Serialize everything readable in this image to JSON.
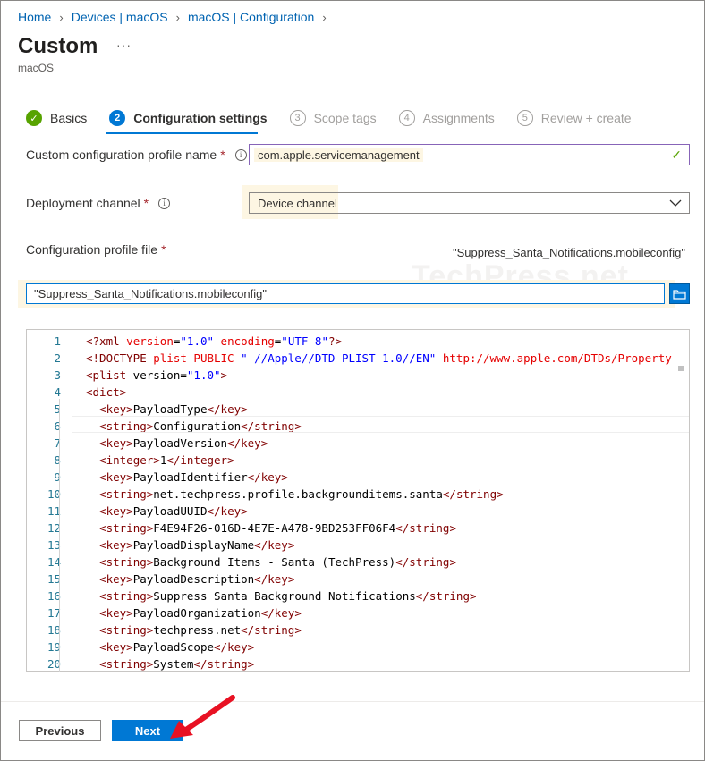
{
  "breadcrumb": [
    "Home",
    "Devices | macOS",
    "macOS | Configuration"
  ],
  "page": {
    "title": "Custom",
    "more": "···",
    "subtitle": "macOS"
  },
  "steps": [
    {
      "num": "✓",
      "label": "Basics",
      "state": "done"
    },
    {
      "num": "2",
      "label": "Configuration settings",
      "state": "active"
    },
    {
      "num": "3",
      "label": "Scope tags",
      "state": "pending"
    },
    {
      "num": "4",
      "label": "Assignments",
      "state": "pending"
    },
    {
      "num": "5",
      "label": "Review + create",
      "state": "pending"
    }
  ],
  "form": {
    "profile_name_label": "Custom configuration profile name",
    "profile_name_value": "com.apple.servicemanagement",
    "channel_label": "Deployment channel",
    "channel_value": "Device channel",
    "file_label": "Configuration profile file",
    "file_name_display": "\"Suppress_Santa_Notifications.mobileconfig\"",
    "file_input_value": "\"Suppress_Santa_Notifications.mobileconfig\"",
    "required_mark": "*",
    "info_mark": "i"
  },
  "watermark": "TechPress.net",
  "code_lines": [
    "1",
    "2",
    "3",
    "4",
    "5",
    "6",
    "7",
    "8",
    "9",
    "10",
    "11",
    "12",
    "13",
    "14",
    "15",
    "16",
    "17",
    "18",
    "19",
    "20"
  ],
  "code_text": [
    "<?xml version=\"1.0\" encoding=\"UTF-8\"?>",
    "<!DOCTYPE plist PUBLIC \"-//Apple//DTD PLIST 1.0//EN\" \"http://www.apple.com/DTDs/Property",
    "<plist version=\"1.0\">",
    "<dict>",
    "  <key>PayloadType</key>",
    "  <string>Configuration</string>",
    "  <key>PayloadVersion</key>",
    "  <integer>1</integer>",
    "  <key>PayloadIdentifier</key>",
    "  <string>net.techpress.profile.backgrounditems.santa</string>",
    "  <key>PayloadUUID</key>",
    "  <string>F4E94F26-016D-4E7E-A478-9BD253FF06F4</string>",
    "  <key>PayloadDisplayName</key>",
    "  <string>Background Items - Santa (TechPress)</string>",
    "  <key>PayloadDescription</key>",
    "  <string>Suppress Santa Background Notifications</string>",
    "  <key>PayloadOrganization</key>",
    "  <string>techpress.net</string>",
    "  <key>PayloadScope</key>",
    "  <string>System</string>"
  ],
  "buttons": {
    "previous": "Previous",
    "next": "Next"
  },
  "colors": {
    "accent": "#0078d4",
    "success": "#57a300",
    "required": "#a4262c",
    "annotation_arrow": "#e81123"
  },
  "icons": {
    "check": "checkmark-icon",
    "chevron": "chevron-down-icon",
    "browse": "folder-browse-icon",
    "info": "info-icon"
  }
}
